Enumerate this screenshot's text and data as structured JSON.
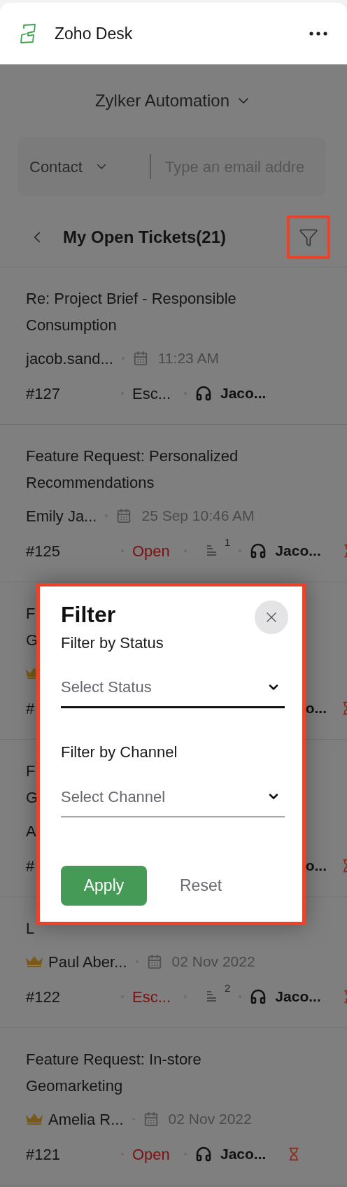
{
  "app": {
    "title": "Zoho Desk"
  },
  "department": {
    "label": "Zylker Automation"
  },
  "search": {
    "scope": "Contact",
    "placeholder": "Type an email addre"
  },
  "list": {
    "title": "My Open Tickets(21)",
    "filter_highlighted": true
  },
  "tickets": [
    {
      "kind": "full",
      "title": "Re: Project Brief - Responsible Consumption",
      "vip": false,
      "requester": "jacob.sand...",
      "time": "11:23 AM",
      "number": "#127",
      "status": "Esc...",
      "agent": "Jaco...",
      "overdue": false
    },
    {
      "kind": "full",
      "title": "Feature Request: Personalized Recommendations",
      "vip": false,
      "requester": "Emily Ja...",
      "time": "25 Sep 10:46 AM",
      "number": "#125",
      "status": "Open",
      "threads": "1",
      "agent": "Jaco...",
      "overdue": true
    },
    {
      "kind": "covered",
      "title_lines": [
        "F",
        "G"
      ],
      "vip": true,
      "number": "#",
      "agent": "o...",
      "overdue": true
    },
    {
      "kind": "covered",
      "title_lines": [
        "F",
        "G"
      ],
      "vip": false,
      "requester": "A",
      "number": "#",
      "agent": "o...",
      "overdue": true
    },
    {
      "kind": "full",
      "title": "L",
      "vip": true,
      "requester": "Paul Aber...",
      "time": "02 Nov 2022",
      "number": "#122",
      "status": "Esc...",
      "threads": "2",
      "agent": "Jaco...",
      "overdue": true
    },
    {
      "kind": "full",
      "title": "Feature Request: In-store Geomarketing",
      "vip": true,
      "requester": "Amelia R...",
      "time": "02 Nov 2022",
      "number": "#121",
      "status": "Open",
      "agent": "Jaco...",
      "overdue": true
    }
  ],
  "filter_dialog": {
    "highlighted": true,
    "title": "Filter",
    "fields": [
      {
        "label": "Filter by Status",
        "placeholder": "Select Status",
        "focused": true
      },
      {
        "label": "Filter by Channel",
        "placeholder": "Select Channel",
        "focused": false
      }
    ],
    "buttons": [
      {
        "label": "Apply",
        "kind": "primary"
      },
      {
        "label": "Reset",
        "kind": "link"
      }
    ]
  }
}
